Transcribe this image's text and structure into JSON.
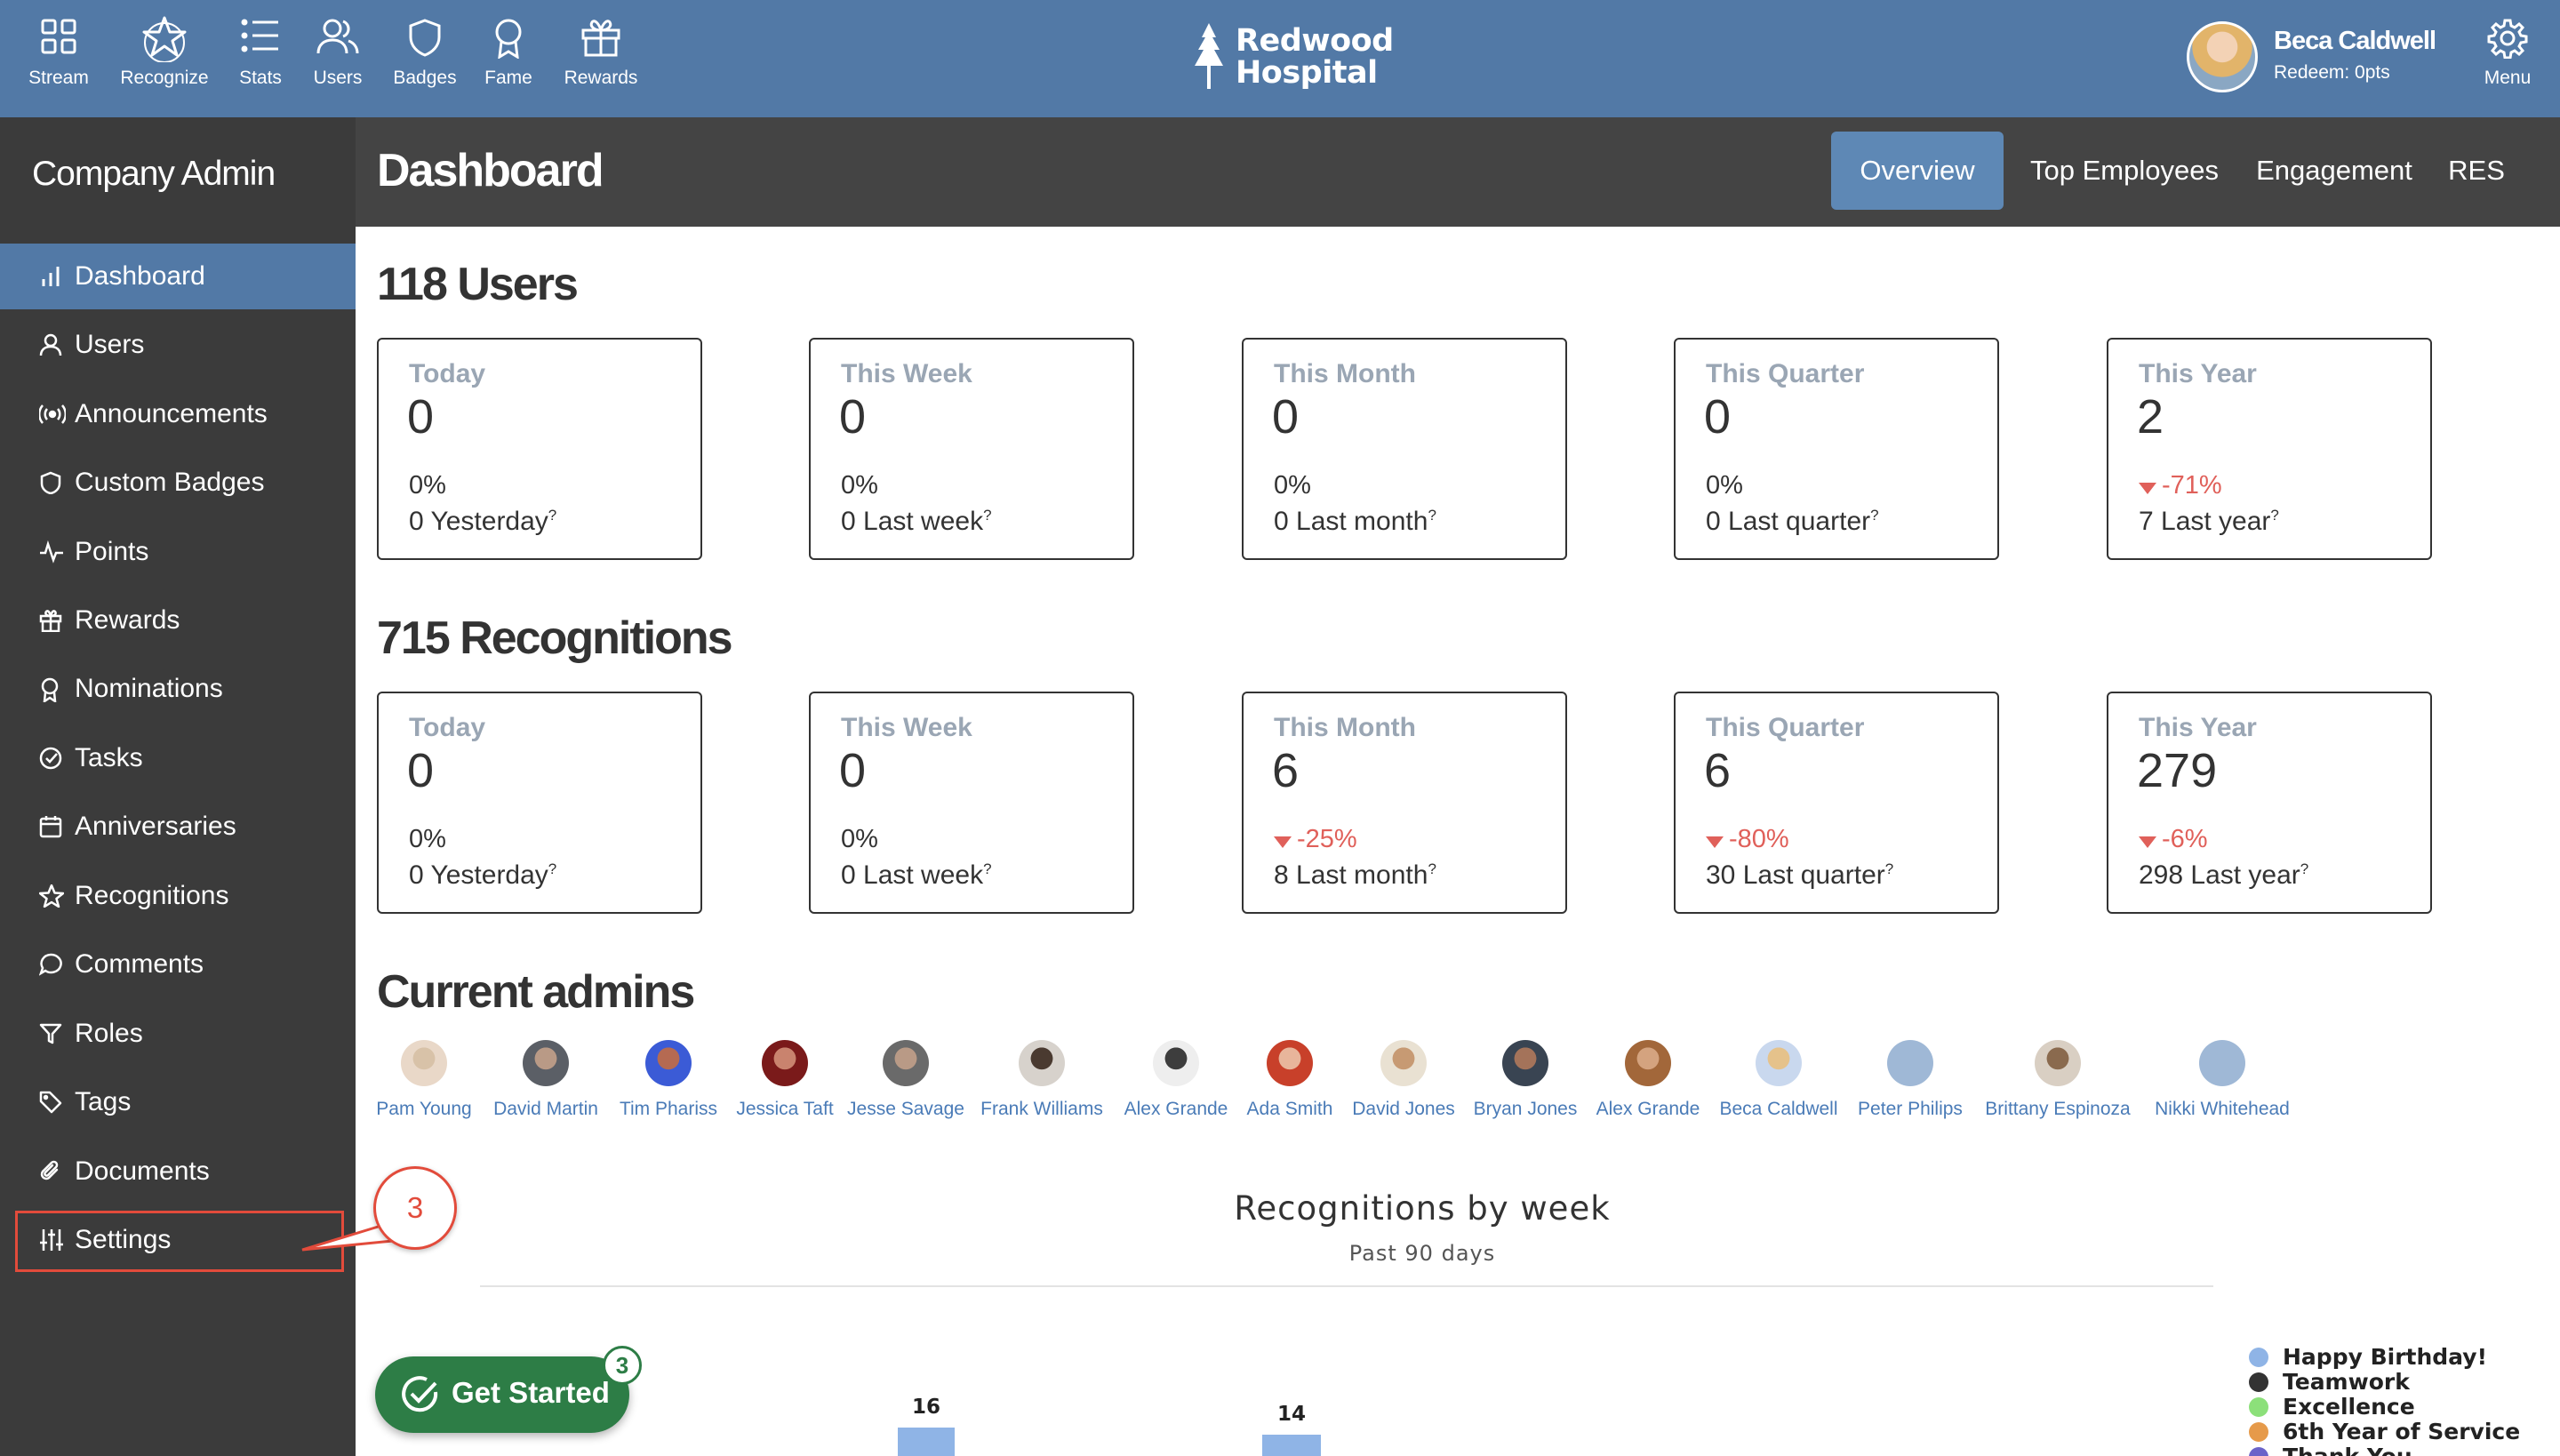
{
  "topnav": {
    "items": [
      {
        "label": "Stream",
        "icon": "grid-icon"
      },
      {
        "label": "Recognize",
        "icon": "star-icon"
      },
      {
        "label": "Stats",
        "icon": "list-icon"
      },
      {
        "label": "Users",
        "icon": "users-icon"
      },
      {
        "label": "Badges",
        "icon": "shield-icon"
      },
      {
        "label": "Fame",
        "icon": "award-icon"
      },
      {
        "label": "Rewards",
        "icon": "gift-icon"
      }
    ],
    "logo_line1": "Redwood",
    "logo_line2": "Hospital",
    "user_name": "Beca Caldwell",
    "user_redeem": "Redeem: 0pts",
    "menu_label": "Menu"
  },
  "sidebar": {
    "title": "Company Admin",
    "items": [
      {
        "label": "Dashboard",
        "icon": "bar-chart-icon"
      },
      {
        "label": "Users",
        "icon": "user-icon"
      },
      {
        "label": "Announcements",
        "icon": "broadcast-icon"
      },
      {
        "label": "Custom Badges",
        "icon": "shield-icon"
      },
      {
        "label": "Points",
        "icon": "pulse-icon"
      },
      {
        "label": "Rewards",
        "icon": "gift-icon"
      },
      {
        "label": "Nominations",
        "icon": "award-icon"
      },
      {
        "label": "Tasks",
        "icon": "check-circle-icon"
      },
      {
        "label": "Anniversaries",
        "icon": "calendar-icon"
      },
      {
        "label": "Recognitions",
        "icon": "star-icon"
      },
      {
        "label": "Comments",
        "icon": "comment-icon"
      },
      {
        "label": "Roles",
        "icon": "filter-icon"
      },
      {
        "label": "Tags",
        "icon": "tag-icon"
      },
      {
        "label": "Documents",
        "icon": "paperclip-icon"
      },
      {
        "label": "Settings",
        "icon": "sliders-icon"
      }
    ],
    "callout": "3"
  },
  "header": {
    "title": "Dashboard",
    "tabs": [
      "Overview",
      "Top Employees",
      "Engagement",
      "RES"
    ]
  },
  "users": {
    "title": "118 Users",
    "cards": [
      {
        "label": "Today",
        "value": "0",
        "pct": "0%",
        "compare": "0 Yesterday",
        "neg": false
      },
      {
        "label": "This Week",
        "value": "0",
        "pct": "0%",
        "compare": "0 Last week",
        "neg": false
      },
      {
        "label": "This Month",
        "value": "0",
        "pct": "0%",
        "compare": "0 Last month",
        "neg": false
      },
      {
        "label": "This Quarter",
        "value": "0",
        "pct": "0%",
        "compare": "0 Last quarter",
        "neg": false
      },
      {
        "label": "This Year",
        "value": "2",
        "pct": "-71%",
        "compare": "7 Last year",
        "neg": true
      }
    ]
  },
  "recognitions": {
    "title": "715 Recognitions",
    "cards": [
      {
        "label": "Today",
        "value": "0",
        "pct": "0%",
        "compare": "0 Yesterday",
        "neg": false
      },
      {
        "label": "This Week",
        "value": "0",
        "pct": "0%",
        "compare": "0 Last week",
        "neg": false
      },
      {
        "label": "This Month",
        "value": "6",
        "pct": "-25%",
        "compare": "8 Last month",
        "neg": true
      },
      {
        "label": "This Quarter",
        "value": "6",
        "pct": "-80%",
        "compare": "30 Last quarter",
        "neg": true
      },
      {
        "label": "This Year",
        "value": "279",
        "pct": "-6%",
        "compare": "298 Last year",
        "neg": true
      }
    ]
  },
  "help_mark": "?",
  "admins": {
    "title": "Current admins",
    "list": [
      "Pam Young",
      "David Martin",
      "Tim Phariss",
      "Jessica Taft",
      "Jesse Savage",
      "Frank Williams",
      "Alex Grande",
      "Ada Smith",
      "David Jones",
      "Bryan Jones",
      "Alex Grande",
      "Beca Caldwell",
      "Peter Philips",
      "Brittany Espinoza",
      "Nikki Whitehead"
    ]
  },
  "chart": {
    "title": "Recognitions by week",
    "subtitle": "Past 90 days"
  },
  "chart_data": {
    "type": "bar",
    "title": "Recognitions by week",
    "subtitle": "Past 90 days",
    "values": [
      16,
      14
    ],
    "colors": {
      "bar": "#8fb4e6",
      "accent": "#5279a6"
    },
    "legend": [
      {
        "name": "Happy Birthday!",
        "color": "#8fb4e6"
      },
      {
        "name": "Teamwork",
        "color": "#333333"
      },
      {
        "name": "Excellence",
        "color": "#8ce07a"
      },
      {
        "name": "6th Year of Service",
        "color": "#e69a4a"
      },
      {
        "name": "Thank You",
        "color": "#6b63c9"
      }
    ],
    "legend_position": "right"
  },
  "get_started": {
    "label": "Get Started",
    "badge": "3"
  }
}
